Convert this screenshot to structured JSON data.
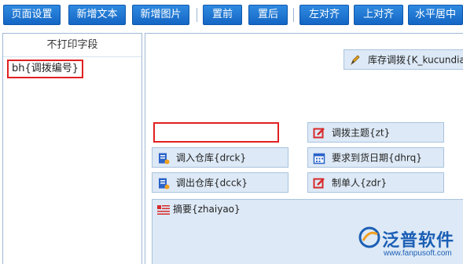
{
  "toolbar": {
    "page_setup": "页面设置",
    "add_text": "新增文本",
    "add_image": "新增图片",
    "bring_front": "置前",
    "send_back": "置后",
    "align_left": "左对齐",
    "align_top": "上对齐",
    "center_horizontal": "水平居中"
  },
  "left_panel": {
    "header": "不打印字段",
    "items": [
      "bh{调拨编号}"
    ]
  },
  "canvas": {
    "title_field": "库存调拨{K_kucundiao",
    "fields": {
      "subject": "调拨主题{zt}",
      "in_warehouse": "调入仓库{drck}",
      "required_date": "要求到货日期{dhrq}",
      "out_warehouse": "调出仓库{dcck}",
      "creator": "制单人{zdr}",
      "summary": "摘要{zhaiyao}"
    }
  },
  "logo": {
    "name": "泛普软件",
    "url": "www.fanpusoft.com"
  },
  "colors": {
    "toolbar_button": "#1a72d0",
    "field_bg": "#dde9f6",
    "highlight_red": "#e02020",
    "brand_blue": "#1b5fb5"
  }
}
